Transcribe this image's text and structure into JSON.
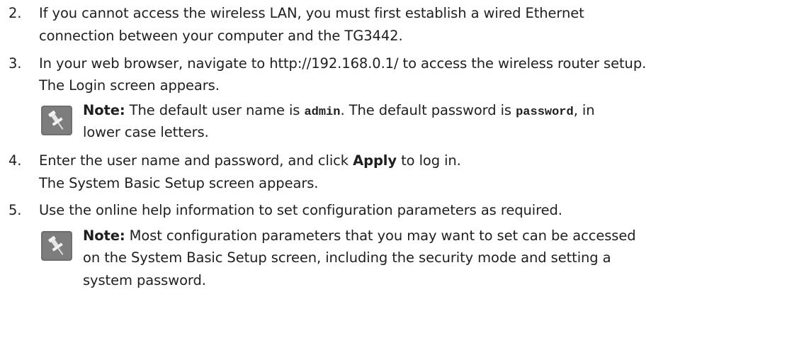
{
  "steps": [
    {
      "number": "2.",
      "line1": "If you cannot access the wireless LAN, you must first establish a wired Ethernet",
      "line2": "connection between your computer and the TG3442."
    },
    {
      "number": "3.",
      "line1": "In your web browser, navigate to http://192.168.0.1/ to access the wireless router setup.",
      "line2": "The Login screen appears.",
      "note": {
        "label": "Note:",
        "l1_a": " The default user name is ",
        "l1_code1": "admin",
        "l1_b": ". The default password is ",
        "l1_code2": "password",
        "l1_c": ", in",
        "l2": "lower case letters."
      }
    },
    {
      "number": "4.",
      "line1_a": "Enter the user name and password, and click ",
      "line1_bold": "Apply",
      "line1_b": " to log in.",
      "line2": "The System Basic Setup screen appears."
    },
    {
      "number": "5.",
      "line1": "Use the online help information to set configuration parameters as required.",
      "note": {
        "label": "Note:",
        "l1": " Most configuration parameters that you may want to set can be accessed",
        "l2": "on the System Basic Setup screen, including the security mode and setting a",
        "l3": "system password."
      }
    }
  ],
  "icons": {
    "note_icon": "pushpin-note-icon",
    "icon_bg": "#6f6f6f",
    "pin_color": "#f2f2f2"
  }
}
